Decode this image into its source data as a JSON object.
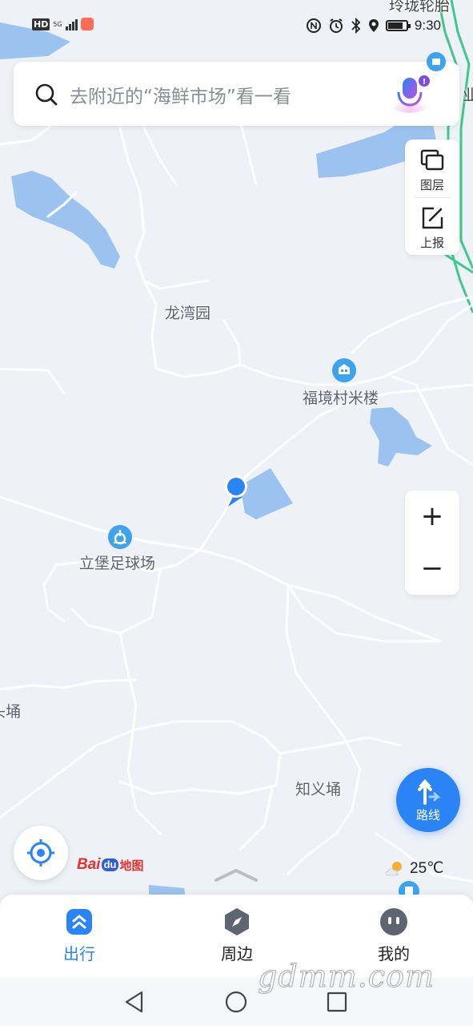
{
  "status_bar": {
    "hd_badge": "HD",
    "network_type": "5G",
    "time": "9:30"
  },
  "search": {
    "placeholder": "去附近的“海鲜市场”看一看",
    "icon": "search-icon",
    "voice_icon": "microphone-icon",
    "voice_badge": "!"
  },
  "map_controls": {
    "layer_label": "图层",
    "report_label": "上报",
    "zoom_in": "+",
    "zoom_out": "−"
  },
  "map_labels": {
    "top_right_poi": "玲珑轮胎",
    "right_edge_partial": "业",
    "longwan": "龙湾园",
    "fujing": "福境村米楼",
    "libao": "立堡足球场",
    "left_partial": "头埇",
    "zhiyi": "知义埇"
  },
  "route_button": {
    "label": "路线"
  },
  "weather": {
    "temperature": "25℃",
    "icon": "partly-cloudy-icon"
  },
  "logo": {
    "bai": "Bai",
    "du": "du",
    "map": "地图"
  },
  "bottom_tabs": [
    {
      "label": "出行",
      "icon": "travel-icon",
      "active": true
    },
    {
      "label": "周边",
      "icon": "compass-icon",
      "active": false
    },
    {
      "label": "我的",
      "icon": "profile-icon",
      "active": false
    }
  ],
  "watermark": "gdmm.com",
  "colors": {
    "accent": "#2a84f5",
    "map_background": "#eef1f6",
    "water": "#9cc3f0",
    "road": "#ffffff",
    "highway": "#3cc98a"
  }
}
